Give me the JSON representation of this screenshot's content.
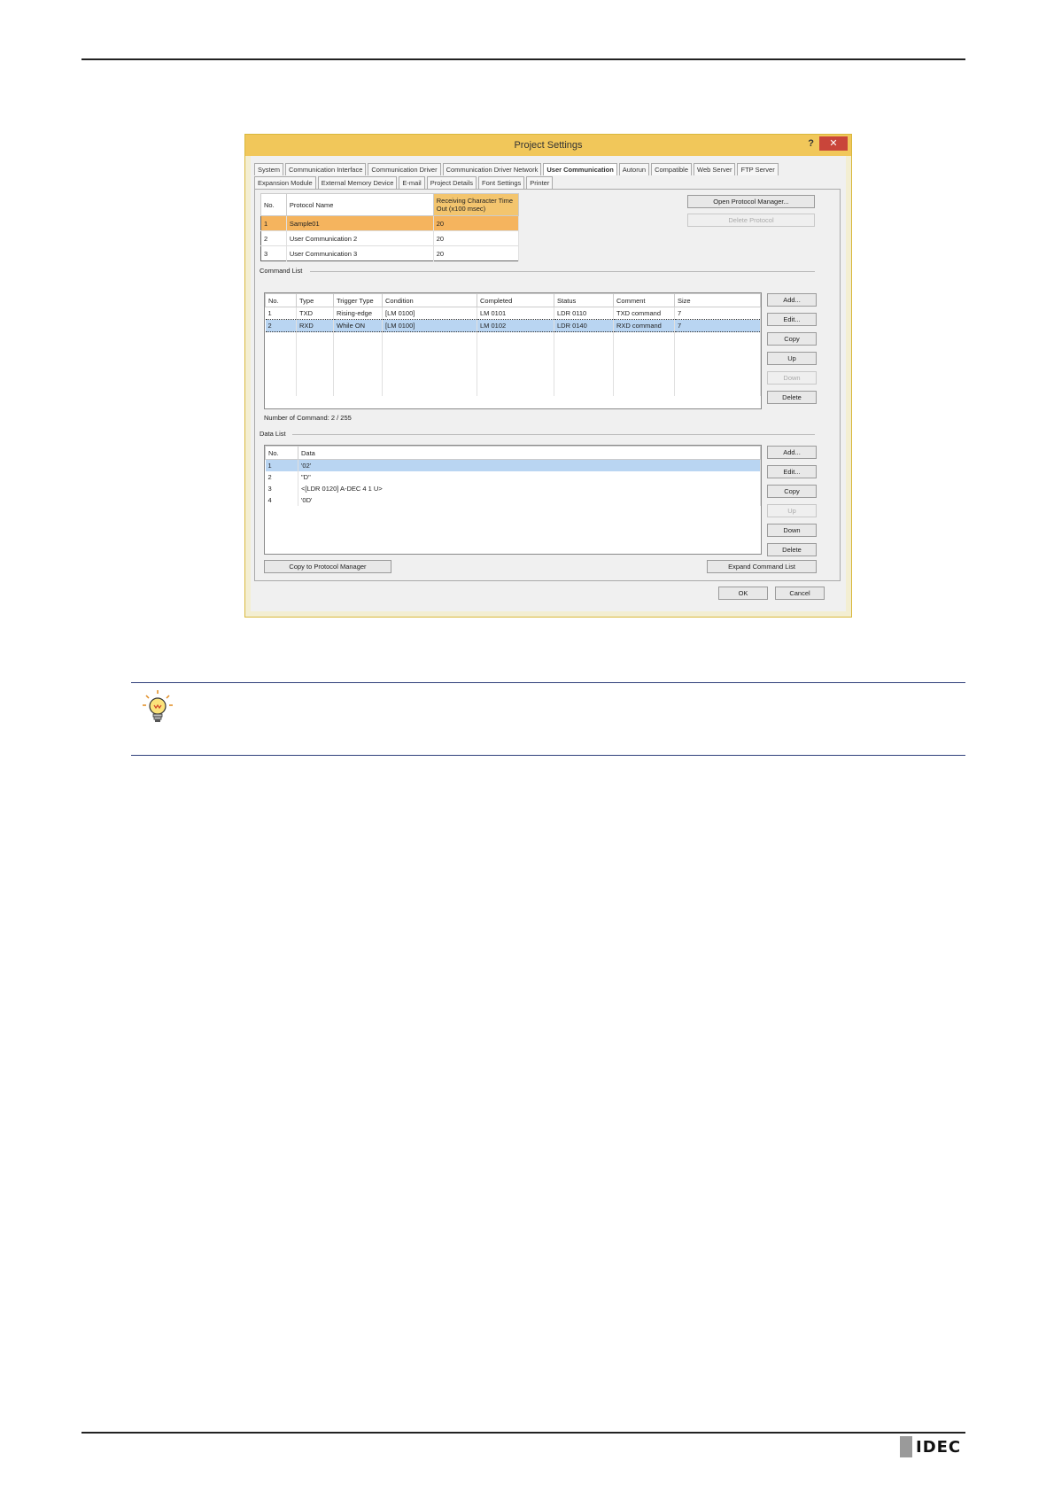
{
  "dialog": {
    "title": "Project Settings",
    "help": "?",
    "close": "✕",
    "tabs_row1": [
      "System",
      "Communication Interface",
      "Communication Driver",
      "Communication Driver Network",
      "User Communication",
      "Autorun",
      "Compatible",
      "Web Server",
      "FTP Server"
    ],
    "tabs_row2": [
      "Expansion Module",
      "External Memory Device",
      "E-mail",
      "Project Details",
      "Font Settings",
      "Printer"
    ],
    "active_tab": "User Communication",
    "protocol_table": {
      "headers": [
        "No.",
        "Protocol Name",
        "Receiving Character Time Out (x100 msec)"
      ],
      "rows": [
        [
          "1",
          "Sample01",
          "20"
        ],
        [
          "2",
          "User Communication 2",
          "20"
        ],
        [
          "3",
          "User Communication 3",
          "20"
        ]
      ]
    },
    "buttons": {
      "open_protocol_manager": "Open Protocol Manager...",
      "delete_protocol": "Delete Protocol",
      "cmd_add": "Add...",
      "cmd_edit": "Edit...",
      "cmd_copy": "Copy",
      "cmd_up": "Up",
      "cmd_down": "Down",
      "cmd_delete": "Delete",
      "data_add": "Add...",
      "data_edit": "Edit...",
      "data_copy": "Copy",
      "data_up": "Up",
      "data_down": "Down",
      "data_delete": "Delete",
      "copy_to_protocol_manager": "Copy to Protocol Manager",
      "expand_command_list": "Expand Command List",
      "ok": "OK",
      "cancel": "Cancel"
    },
    "command_list": {
      "label": "Command List",
      "headers": [
        "No.",
        "Type",
        "Trigger Type",
        "Condition",
        "Completed",
        "Status",
        "Comment",
        "Size"
      ],
      "rows": [
        [
          "1",
          "TXD",
          "Rising-edge",
          "[LM 0100]",
          "LM 0101",
          "LDR 0110",
          "TXD command",
          "7"
        ],
        [
          "2",
          "RXD",
          "While ON",
          "[LM 0100]",
          "LM 0102",
          "LDR 0140",
          "RXD command",
          "7"
        ]
      ],
      "count": "Number of Command: 2 / 255"
    },
    "data_list": {
      "label": "Data List",
      "headers": [
        "No.",
        "Data"
      ],
      "rows": [
        [
          "1",
          "'02'"
        ],
        [
          "2",
          "\"D\""
        ],
        [
          "3",
          "<[LDR 0120] A-DEC 4 1 U>"
        ],
        [
          "4",
          "'0D'"
        ]
      ]
    }
  },
  "tip_icon": "lightbulb-icon",
  "logo": "IDEC"
}
